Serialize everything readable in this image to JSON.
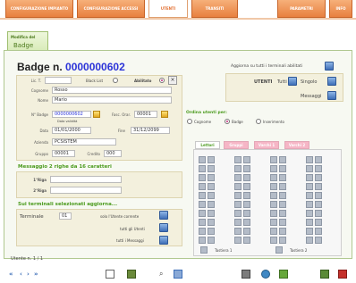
{
  "nav": {
    "tabs": [
      {
        "label": "CONFIGURAZIONE IMPIANTO"
      },
      {
        "label": "CONFIGURAZIONE ACCESSI"
      },
      {
        "label": "UTENTI"
      },
      {
        "label": "TRANSITI"
      },
      {
        "label": "PARAMETRI"
      },
      {
        "label": "INFO"
      }
    ],
    "active": "UTENTI"
  },
  "subtab": {
    "line1": "Modifica del",
    "line2": "Badge"
  },
  "badge": {
    "title_prefix": "Badge n.",
    "number": "0000000602",
    "update_label": "Aggiorna su tutti i terminali abilitati"
  },
  "status_row": {
    "id_label": "Lic. T.",
    "blacklist_label": "Black List",
    "abilitato_label": "Abilitato"
  },
  "fields": [
    {
      "label": "Cognome",
      "value": "Rosso"
    },
    {
      "label": "Nome",
      "value": "Mario"
    },
    {
      "label": "N° Badge",
      "value": "0000000602"
    },
    {
      "label": "Data",
      "value": "01/01/2000"
    },
    {
      "label": "Azienda",
      "value": "PCSISTEM"
    },
    {
      "label": "Gruppo",
      "value": "00001"
    }
  ],
  "extra": {
    "fasc_label": "Fasc. Orar.",
    "fasc_value": "00001",
    "data_validita_label": "Data validità",
    "fine_label": "Fine",
    "fine_value": "31/12/2099",
    "credito_label": "Credito",
    "credito_value": "000"
  },
  "utenti": {
    "label": "UTENTI",
    "tutti": "Tutti",
    "singolo": "Singolo",
    "messaggi": "Messaggi"
  },
  "messaggio": {
    "title": "Messaggio 2 righe da 16 caratteri",
    "riga1_label": "1°Riga",
    "riga2_label": "2°Riga",
    "riga1_value": "",
    "riga2_value": ""
  },
  "ordina": {
    "title": "Ordina utenti per:",
    "options": [
      "Cognome",
      "Badge",
      "Inserimento"
    ],
    "selected": "Badge"
  },
  "terminali": {
    "title": "Sui terminali selezionati aggiorna...",
    "row1_label": "Terminale",
    "row1_value": "01",
    "row1_text": "solo l'Utente corrente",
    "row2_text": "tutti gli Utenti",
    "row3_text": "tutti i Messaggi"
  },
  "inner_tabs": [
    "Lettori",
    "Gruppi",
    "Varchi 1",
    "Varchi 2"
  ],
  "legend": {
    "tast1": "Tastiera 1",
    "tast2": "Tastiera 2"
  },
  "pagination": {
    "text": "Utente n. 1 / 1"
  },
  "colors": {
    "accent_orange": "#e8803f",
    "accent_green": "#4a9a1c",
    "badge_blue": "#2c34d8"
  },
  "toolbar_icons": [
    "first-icon",
    "prev-icon",
    "next-icon",
    "last-icon",
    "new-icon",
    "save-icon",
    "search-icon",
    "find-icon",
    "print-icon",
    "globe-icon",
    "export-icon",
    "bin-icon",
    "delete-icon"
  ]
}
